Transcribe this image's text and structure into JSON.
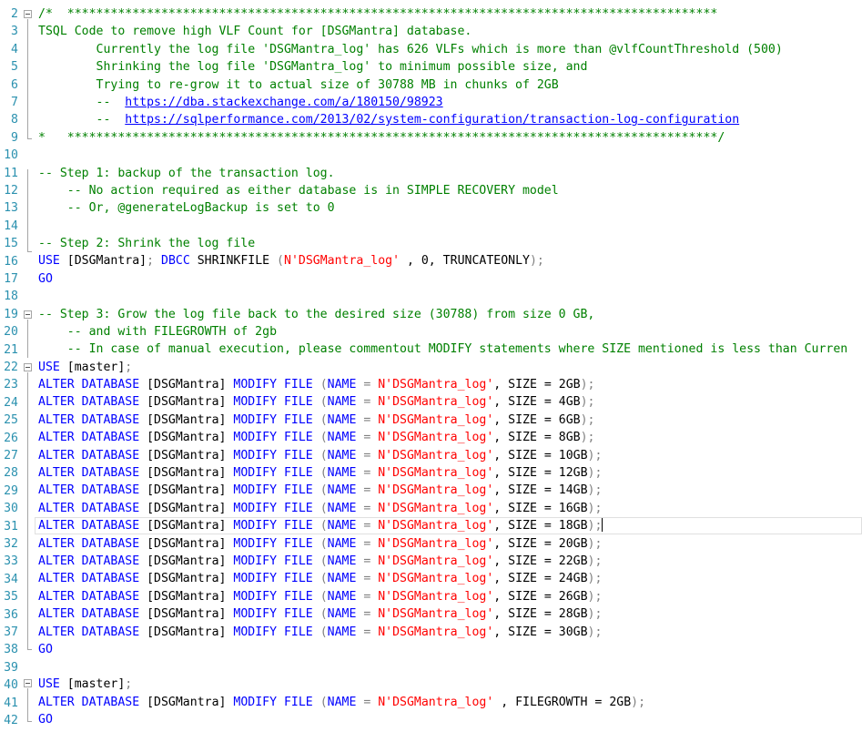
{
  "editor": {
    "line_numbers": [
      "2",
      "3",
      "4",
      "5",
      "6",
      "7",
      "8",
      "9",
      "10",
      "11",
      "12",
      "13",
      "14",
      "15",
      "16",
      "17",
      "18",
      "19",
      "20",
      "21",
      "22",
      "23",
      "24",
      "25",
      "26",
      "27",
      "28",
      "29",
      "30",
      "31",
      "32",
      "33",
      "34",
      "35",
      "36",
      "37",
      "38",
      "39",
      "40",
      "41",
      "42"
    ],
    "comment_header": {
      "open": "/*  ******************************************************************************************",
      "title": "TSQL Code to remove high VLF Count for [DSGMantra] database.",
      "line1": "        Currently the log file 'DSGMantra_log' has 626 VLFs which is more than @vlfCountThreshold (500)",
      "line2": "        Shrinking the log file 'DSGMantra_log' to minimum possible size, and",
      "line3": "        Trying to re-grow it to actual size of 30788 MB in chunks of 2GB",
      "link1_prefix": "        --  ",
      "link1": "https://dba.stackexchange.com/a/180150/98923",
      "link2_prefix": "        --  ",
      "link2": "https://sqlperformance.com/2013/02/system-configuration/transaction-log-configuration",
      "close": "*   ******************************************************************************************/"
    },
    "step1": {
      "title": "-- Step 1: backup of the transaction log.",
      "note1": "    -- No action required as either database is in SIMPLE RECOVERY model",
      "note2": "    -- Or, @generateLogBackup is set to 0"
    },
    "step2": {
      "title": "-- Step 2: Shrink the log file",
      "use_kw": "USE",
      "db": " [DSGMantra]",
      "semi": ";",
      "dbcc": " DBCC",
      "shrink": " SHRINKFILE ",
      "open": "(",
      "file": "N'DSGMantra_log'",
      "args": " , 0, TRUNCATEONLY",
      "close": ");",
      "go": "GO"
    },
    "step3": {
      "title": "-- Step 3: Grow the log file back to the desired size (30788) from size 0 GB,",
      "note1": "    -- and with FILEGROWTH of 2gb",
      "note2": "    -- In case of manual execution, please commentout MODIFY statements where SIZE mentioned is less than Curren",
      "use_kw": "USE",
      "master": " [master]",
      "semi": ";",
      "alter_kw": "ALTER",
      "database_kw": " DATABASE",
      "db": " [DSGMantra]",
      "modify_kw": " MODIFY",
      "file_kw": " FILE",
      "name_kw": "NAME",
      "eq": " = ",
      "file": "N'DSGMantra_log'",
      "size_label": ", SIZE = ",
      "sizes": [
        "2GB",
        "4GB",
        "6GB",
        "8GB",
        "10GB",
        "12GB",
        "14GB",
        "16GB",
        "18GB",
        "20GB",
        "22GB",
        "24GB",
        "26GB",
        "28GB",
        "30GB"
      ],
      "go": "GO"
    },
    "step4": {
      "use_kw": "USE",
      "master": " [master]",
      "semi": ";",
      "growth_label": " , FILEGROWTH = 2GB",
      "close": ");",
      "go": "GO"
    }
  }
}
